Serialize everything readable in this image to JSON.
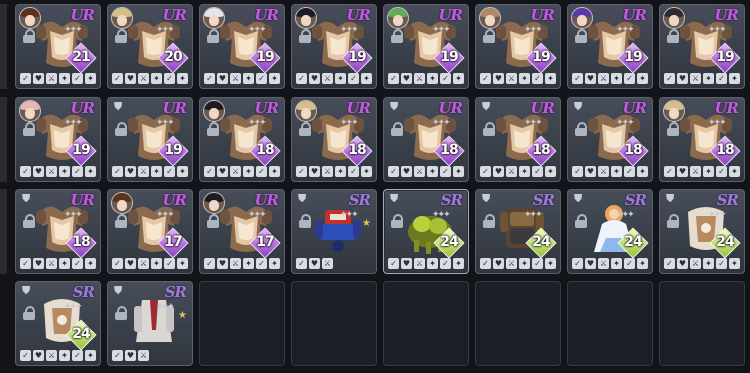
{
  "inventory": {
    "cards": [
      {
        "rank": "UR",
        "level": "21",
        "portrait": "brown-hair",
        "levelStyle": "purple"
      },
      {
        "rank": "UR",
        "level": "20",
        "portrait": "blonde-hair",
        "levelStyle": "purple"
      },
      {
        "rank": "UR",
        "level": "19",
        "portrait": "white-hair",
        "levelStyle": "purple"
      },
      {
        "rank": "UR",
        "level": "19",
        "portrait": "black-hair",
        "levelStyle": "purple"
      },
      {
        "rank": "UR",
        "level": "19",
        "portrait": "green-hair",
        "levelStyle": "purple"
      },
      {
        "rank": "UR",
        "level": "19",
        "portrait": "light-brown-hair",
        "levelStyle": "purple"
      },
      {
        "rank": "UR",
        "level": "19",
        "portrait": "purple-hair",
        "levelStyle": "purple"
      },
      {
        "rank": "UR",
        "level": "19",
        "portrait": "dark-hair",
        "levelStyle": "purple"
      },
      {
        "rank": "UR",
        "level": "19",
        "portrait": "pink-hair",
        "levelStyle": "purple"
      },
      {
        "rank": "UR",
        "level": "19",
        "portrait": "none",
        "levelStyle": "purple"
      },
      {
        "rank": "UR",
        "level": "18",
        "portrait": "black-hair",
        "levelStyle": "purple"
      },
      {
        "rank": "UR",
        "level": "18",
        "portrait": "blonde-hair",
        "levelStyle": "purple"
      },
      {
        "rank": "UR",
        "level": "18",
        "portrait": "none",
        "levelStyle": "purple"
      },
      {
        "rank": "UR",
        "level": "18",
        "portrait": "none",
        "levelStyle": "purple"
      },
      {
        "rank": "UR",
        "level": "18",
        "portrait": "none",
        "levelStyle": "purple"
      },
      {
        "rank": "UR",
        "level": "18",
        "portrait": "blonde-hair",
        "levelStyle": "purple"
      },
      {
        "rank": "UR",
        "level": "18",
        "portrait": "none",
        "levelStyle": "purple"
      },
      {
        "rank": "UR",
        "level": "17",
        "portrait": "brown-hair",
        "levelStyle": "purple"
      },
      {
        "rank": "UR",
        "level": "17",
        "portrait": "black-hair",
        "levelStyle": "purple"
      },
      {
        "rank": "SR",
        "level": "",
        "portrait": "none",
        "levelStyle": "none",
        "art": "robot"
      },
      {
        "rank": "SR",
        "level": "24",
        "portrait": "none",
        "levelStyle": "green",
        "art": "green-beast",
        "selected": true
      },
      {
        "rank": "SR",
        "level": "24",
        "portrait": "none",
        "levelStyle": "green",
        "art": "bronze-armor"
      },
      {
        "rank": "SR",
        "level": "24",
        "portrait": "none",
        "levelStyle": "green",
        "art": "white-dress"
      },
      {
        "rank": "SR",
        "level": "24",
        "portrait": "none",
        "levelStyle": "green",
        "art": "light-armor"
      },
      {
        "rank": "SR",
        "level": "24",
        "portrait": "none",
        "levelStyle": "green",
        "art": "light-armor"
      },
      {
        "rank": "SR",
        "level": "",
        "portrait": "none",
        "levelStyle": "none",
        "art": "white-coat"
      }
    ],
    "empty_slots": 6
  },
  "colors": {
    "ur": "#c05ae0",
    "sr": "#9d7ad6",
    "card_bg": "#414853",
    "empty_bg": "#1c1f25"
  },
  "icons": {
    "lock": "lock-icon",
    "armor": "chestplate-icon",
    "star": "star-icon"
  }
}
